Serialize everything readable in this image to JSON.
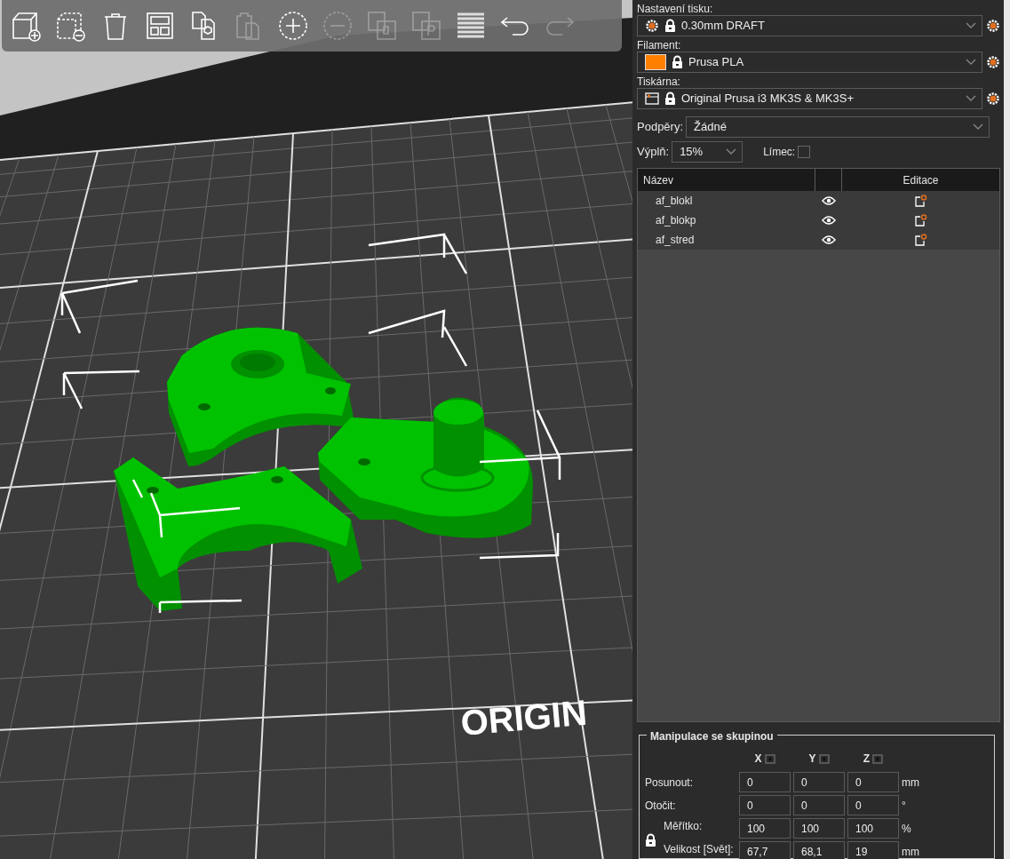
{
  "toolbar": {
    "tools": [
      {
        "kind": "add",
        "disabled": false
      },
      {
        "kind": "remove",
        "disabled": false
      },
      {
        "kind": "delete",
        "disabled": false
      },
      {
        "kind": "arrange",
        "disabled": false
      },
      {
        "kind": "copy",
        "disabled": false
      },
      {
        "kind": "paste",
        "disabled": true
      },
      {
        "kind": "add_instance",
        "disabled": false
      },
      {
        "kind": "remove_instance",
        "disabled": true
      },
      {
        "kind": "split_objects",
        "disabled": true
      },
      {
        "kind": "split_parts",
        "disabled": true
      },
      {
        "kind": "layers",
        "disabled": false
      },
      {
        "kind": "undo",
        "disabled": false
      },
      {
        "kind": "redo",
        "disabled": true
      }
    ]
  },
  "viewport": {
    "bed_label": "ORIGIN"
  },
  "sidebar": {
    "presets": [
      {
        "label": "Nastavení tisku:",
        "kind": "print",
        "value": "0.30mm DRAFT"
      },
      {
        "label": "Filament:",
        "kind": "filament",
        "value": "Prusa PLA",
        "color": "#ff8000"
      },
      {
        "label": "Tiskárna:",
        "kind": "printer",
        "value": "Original Prusa i3 MK3S & MK3S+"
      }
    ],
    "supports": {
      "label": "Podpěry:",
      "value": "Žádné"
    },
    "infill": {
      "label": "Výplň:",
      "value": "15%"
    },
    "brim": {
      "label": "Límec:",
      "checked": false
    },
    "object_list": {
      "columns": [
        {
          "label": "Název"
        },
        {
          "label": "Editace"
        }
      ],
      "rows": [
        {
          "name": "af_blokl",
          "visible": true
        },
        {
          "name": "af_blokp",
          "visible": true
        },
        {
          "name": "af_stred",
          "visible": true
        }
      ]
    },
    "manipulation": {
      "title": "Manipulace se skupinou",
      "axes": [
        "X",
        "Y",
        "Z"
      ],
      "rows": [
        {
          "label": "Posunout:",
          "kind": "plain",
          "values": [
            "0",
            "0",
            "0"
          ],
          "unit": "mm"
        },
        {
          "label": "Otočit:",
          "kind": "plain",
          "values": [
            "0",
            "0",
            "0"
          ],
          "unit": "°"
        },
        {
          "label": "Měřítko:",
          "kind": "locked",
          "values": [
            "100",
            "100",
            "100"
          ],
          "unit": "%"
        },
        {
          "label": "Velikost [Svět]:",
          "kind": "locked",
          "values": [
            "67,7",
            "68,1",
            "19"
          ],
          "unit": "mm"
        }
      ]
    }
  }
}
